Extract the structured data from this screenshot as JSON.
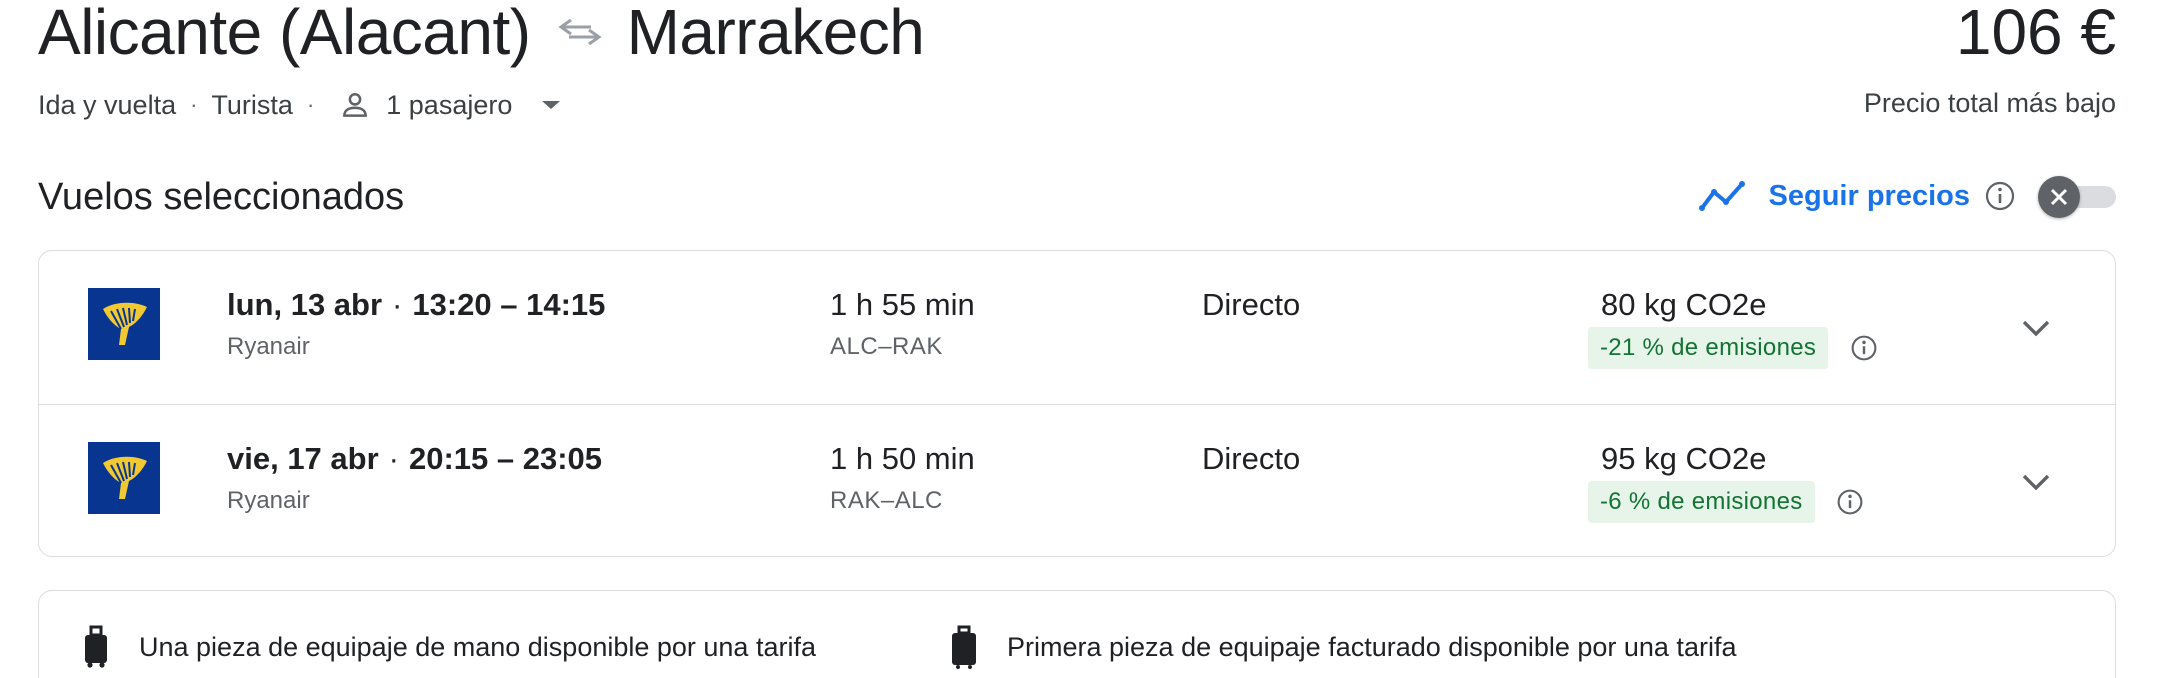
{
  "header": {
    "origin": "Alicante (Alacant)",
    "destination": "Marrakech",
    "swap_icon": "swap-arrows-icon",
    "price": "106 €",
    "price_caption": "Precio total más bajo"
  },
  "trip": {
    "type": "Ida y vuelta",
    "cabin": "Turista",
    "separator": "·",
    "passengers": "1 pasajero"
  },
  "selected": {
    "title": "Vuelos seleccionados",
    "track_label": "Seguir precios",
    "track_enabled": false
  },
  "flights": [
    {
      "date": "lun, 13 abr",
      "times": "13:20 – 14:15",
      "airline": "Ryanair",
      "duration": "1 h 55 min",
      "airports": "ALC–RAK",
      "stops": "Directo",
      "co2": "80 kg CO2e",
      "emissions_badge": "-21 % de emisiones"
    },
    {
      "date": "vie, 17 abr",
      "times": "20:15 – 23:05",
      "airline": "Ryanair",
      "duration": "1 h 50 min",
      "airports": "RAK–ALC",
      "stops": "Directo",
      "co2": "95 kg CO2e",
      "emissions_badge": "-6 % de emisiones"
    }
  ],
  "baggage": {
    "carry_on": "Una pieza de equipaje de mano disponible por una tarifa",
    "checked": "Primera pieza de equipaje facturado disponible por una tarifa"
  },
  "colors": {
    "accent": "#1a73e8",
    "ryanair_blue": "#073590",
    "ryanair_yellow": "#f1c933",
    "eco_bg": "#e6f4ea",
    "eco_text": "#137333"
  }
}
